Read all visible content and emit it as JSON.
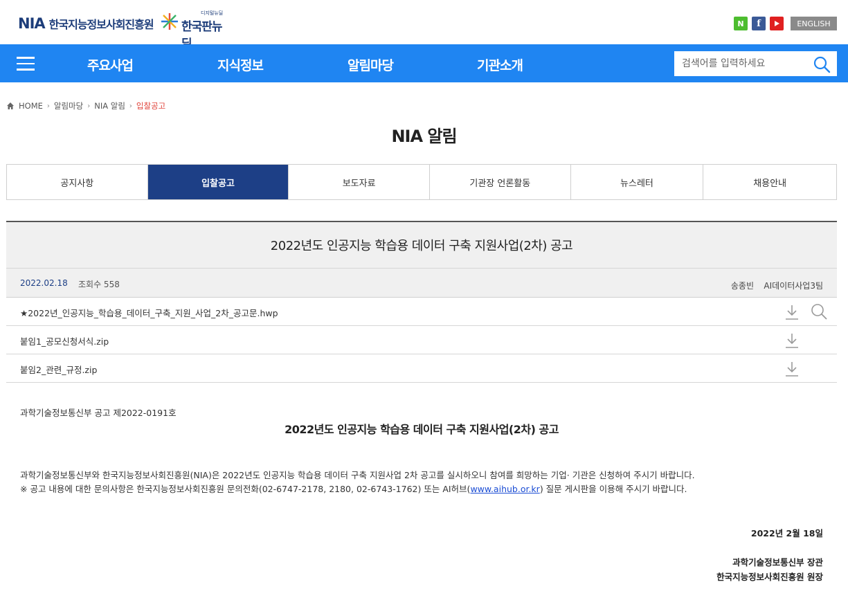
{
  "header": {
    "logo_mark": "NIA",
    "logo_name": "한국지능정보사회진흥원",
    "deal_small": "디지털뉴딜",
    "deal_big": "한국판뉴딜",
    "sns": {
      "naver": "N",
      "facebook": "f",
      "youtube": "▶"
    },
    "english_label": "ENGLISH"
  },
  "gnb": {
    "items": [
      "주요사업",
      "지식정보",
      "알림마당",
      "기관소개"
    ],
    "search_placeholder": "검색어를 입력하세요"
  },
  "breadcrumb": {
    "home": "HOME",
    "items": [
      "알림마당",
      "NIA 알림",
      "입찰공고"
    ]
  },
  "page_title": "NIA 알림",
  "tabs": [
    "공지사항",
    "입찰공고",
    "보도자료",
    "기관장 언론활동",
    "뉴스레터",
    "채용안내"
  ],
  "post": {
    "title": "2022년도 인공지능 학습용 데이터 구축 지원사업(2차) 공고",
    "date": "2022.02.18",
    "views": "조회수 558",
    "author": "송종빈",
    "dept": "AI데이터사업3팀",
    "files": [
      "★2022년_인공지능_학습용_데이터_구축_지원_사업_2차_공고문.hwp",
      "붙임1_공모신청서식.zip",
      "붙임2_관련_규정.zip"
    ]
  },
  "body": {
    "notice_no": "과학기술정보통신부 공고 제2022-0191호",
    "title": "2022년도 인공지능 학습용 데이터 구축 지원사업(2차) 공고",
    "para1": "과학기술정보통신부와 한국지능정보사회진흥원(NIA)은 2022년도 인공지능 학습용 데이터 구축 지원사업 2차 공고를 실시하오니 참여를 희망하는 기업· 기관은 신청하여 주시기 바랍니다.",
    "para2_before": "※ 공고 내용에 대한 문의사항은 한국지능정보사회진흥원 문의전화(02-6747-2178, 2180, 02-6743-1762) 또는 AI허브(",
    "para2_link": "www.aihub.or.kr",
    "para2_after": ") 질문 게시판을 이용해 주시기 바랍니다.",
    "date": "2022년 2월 18일",
    "signer1": "과학기술정보통신부 장관",
    "signer2": "한국지능정보사회진흥원 원장"
  }
}
